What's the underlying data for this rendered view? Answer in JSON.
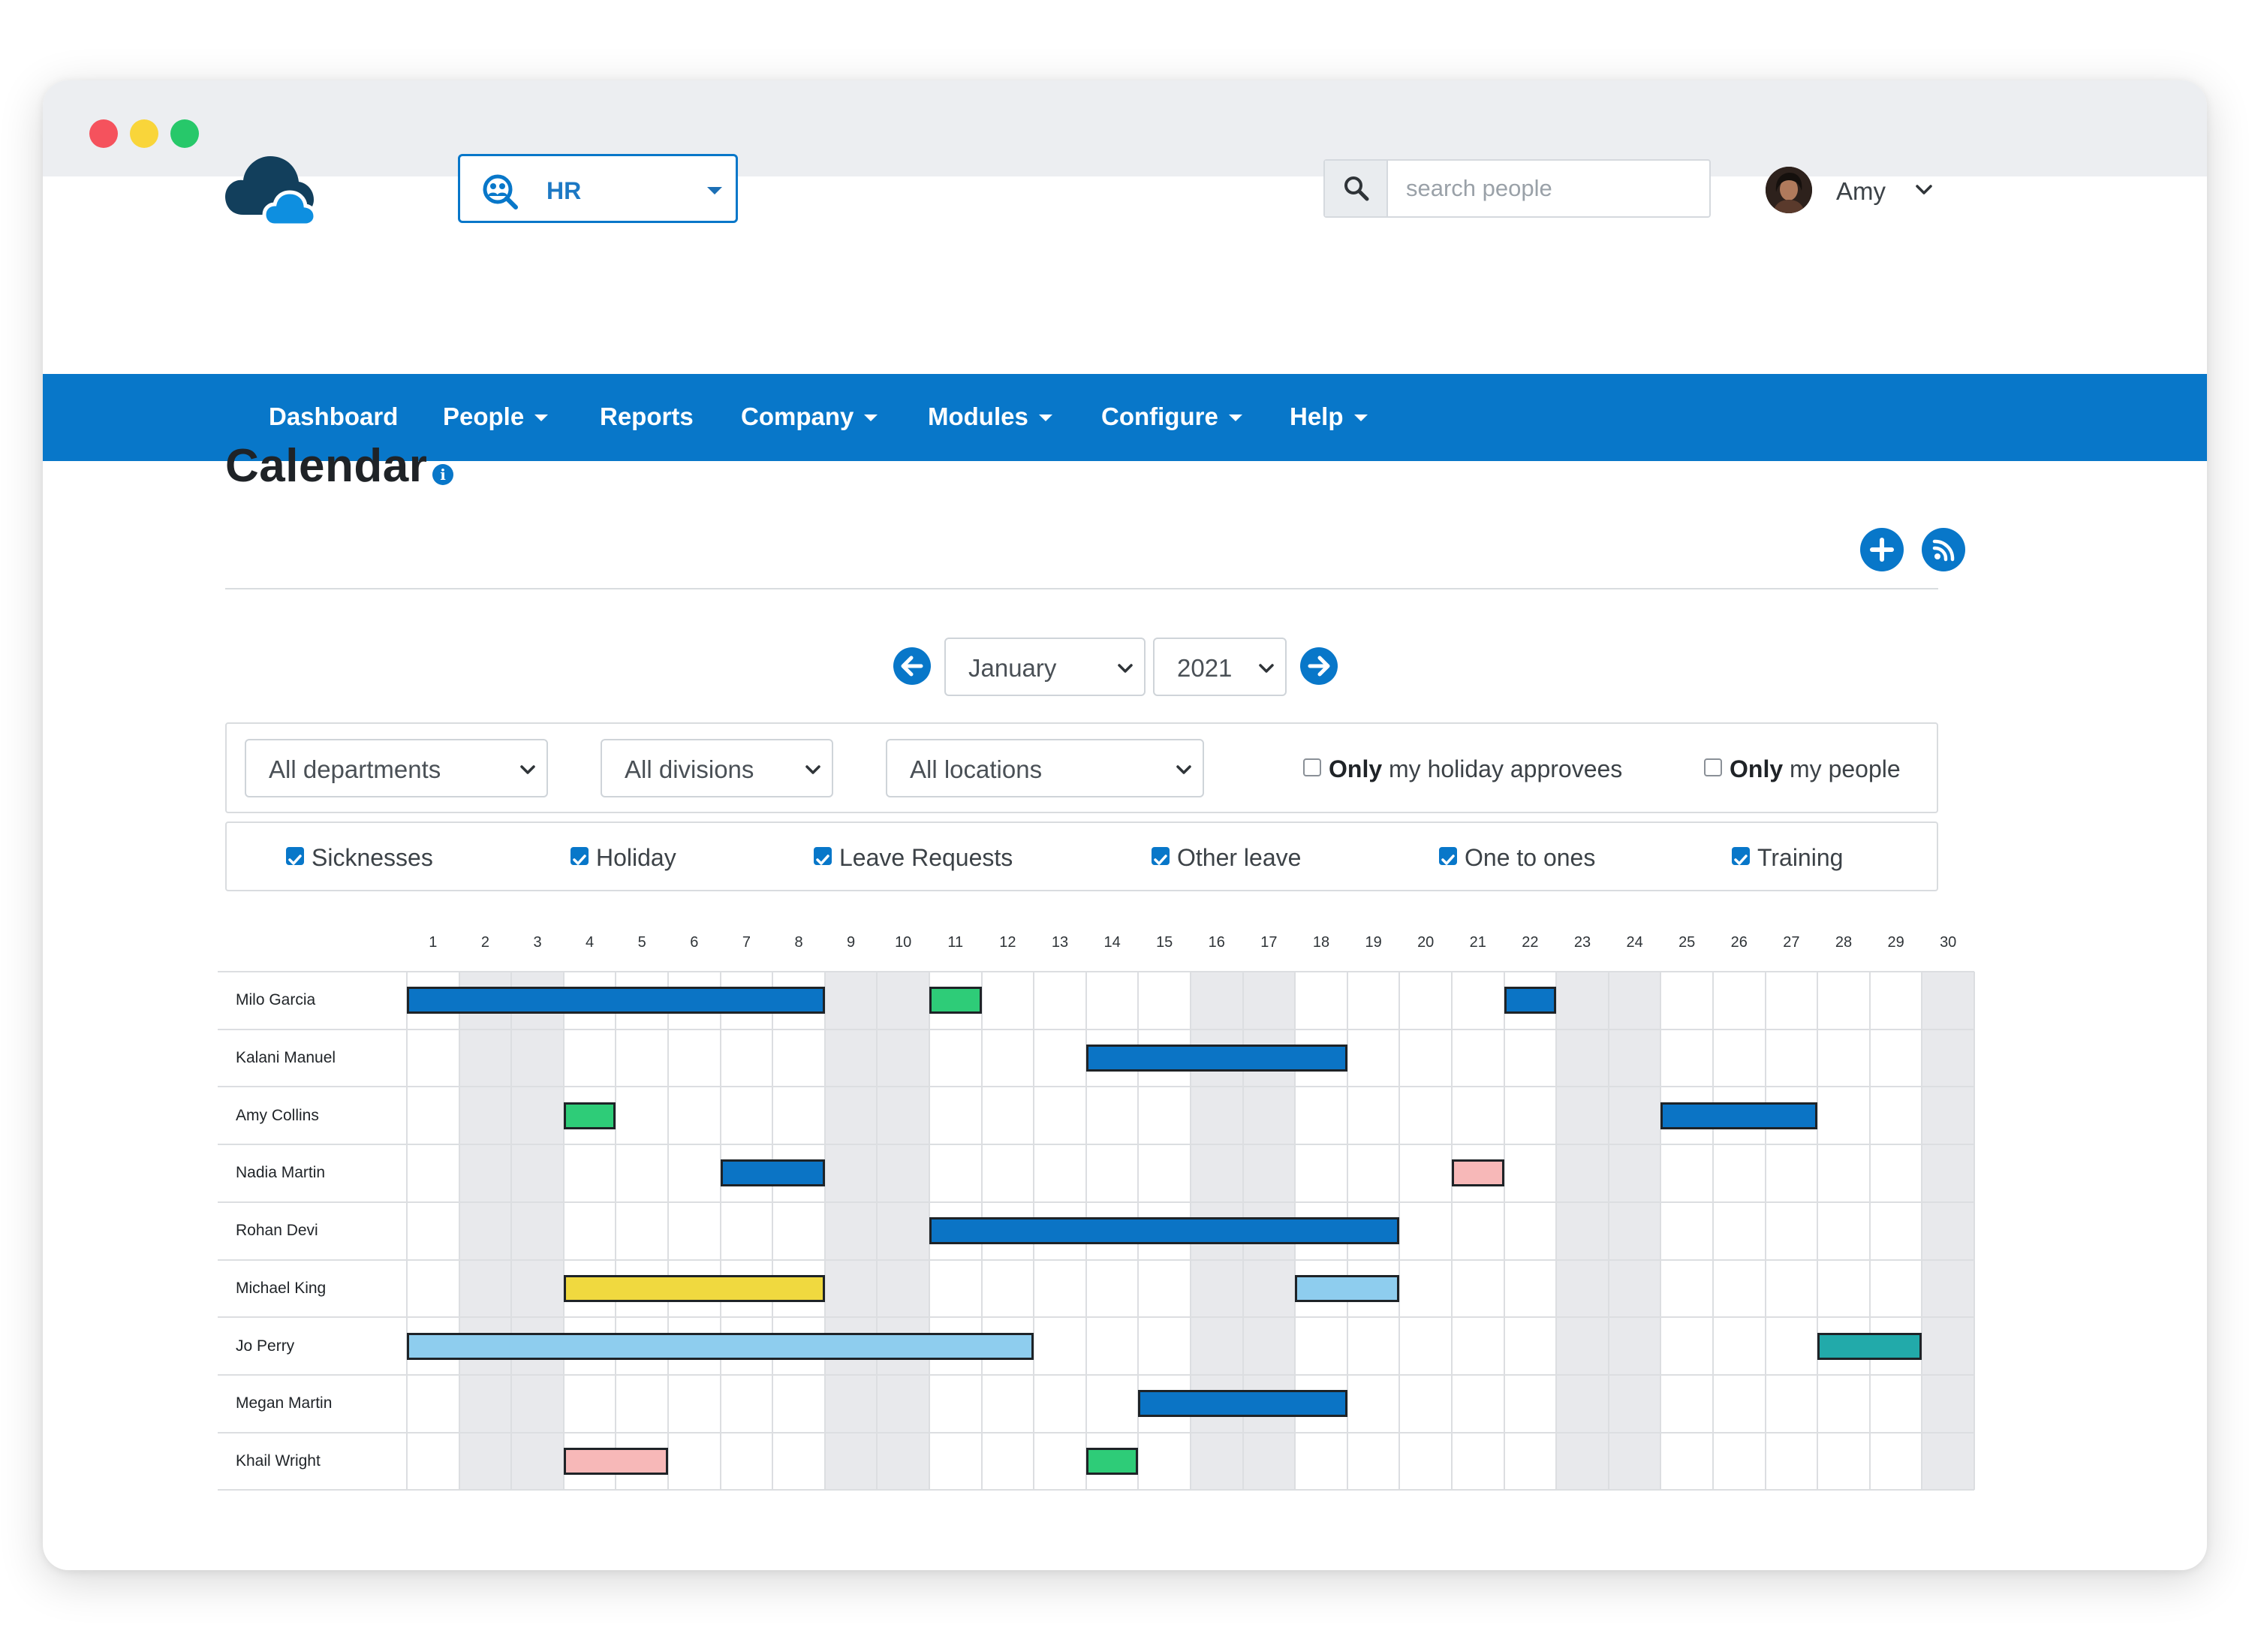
{
  "header": {
    "module": {
      "label": "HR"
    },
    "search": {
      "placeholder": "search people"
    },
    "user": {
      "name": "Amy"
    }
  },
  "nav": [
    {
      "label": "Dashboard",
      "dropdown": false
    },
    {
      "label": "People",
      "dropdown": true
    },
    {
      "label": "Reports",
      "dropdown": false
    },
    {
      "label": "Company",
      "dropdown": true
    },
    {
      "label": "Modules",
      "dropdown": true
    },
    {
      "label": "Configure",
      "dropdown": true
    },
    {
      "label": "Help",
      "dropdown": true
    }
  ],
  "page": {
    "title": "Calendar",
    "info_glyph": "i"
  },
  "period": {
    "month": "January",
    "year": "2021"
  },
  "filters": {
    "department": "All departments",
    "division": "All divisions",
    "location": "All locations",
    "holiday_approvees": {
      "bold": "Only",
      "rest": " my holiday approvees",
      "checked": false
    },
    "my_people": {
      "bold": "Only",
      "rest": " my people",
      "checked": false
    }
  },
  "leave_types": [
    {
      "label": "Sicknesses",
      "checked": true
    },
    {
      "label": "Holiday",
      "checked": true
    },
    {
      "label": "Leave Requests",
      "checked": true
    },
    {
      "label": "Other leave",
      "checked": true
    },
    {
      "label": "One to ones",
      "checked": true
    },
    {
      "label": "Training",
      "checked": true
    }
  ],
  "calendar": {
    "days": [
      "1",
      "2",
      "3",
      "4",
      "5",
      "6",
      "7",
      "8",
      "9",
      "10",
      "11",
      "12",
      "13",
      "14",
      "15",
      "16",
      "17",
      "18",
      "19",
      "20",
      "21",
      "22",
      "23",
      "24",
      "25",
      "26",
      "27",
      "28",
      "29",
      "30"
    ],
    "weekend_days": [
      2,
      3,
      9,
      10,
      16,
      17,
      23,
      24,
      30
    ],
    "colors": {
      "holiday": "#0b74c5",
      "sickness": "#2ecc78",
      "training": "#f0d93f",
      "leave_request": "#8ecdee",
      "other_leave": "#f7b8b8",
      "one_to_one": "#22aaaa"
    },
    "people": [
      {
        "name": "Milo Garcia",
        "events": [
          {
            "start": 1,
            "end": 8,
            "type": "holiday"
          },
          {
            "start": 11,
            "end": 11,
            "type": "sickness"
          },
          {
            "start": 22,
            "end": 22,
            "type": "holiday"
          }
        ]
      },
      {
        "name": "Kalani Manuel",
        "events": [
          {
            "start": 14,
            "end": 18,
            "type": "holiday"
          }
        ]
      },
      {
        "name": "Amy Collins",
        "events": [
          {
            "start": 4,
            "end": 4,
            "type": "sickness"
          },
          {
            "start": 25,
            "end": 27,
            "type": "holiday"
          }
        ]
      },
      {
        "name": "Nadia Martin",
        "events": [
          {
            "start": 7,
            "end": 8,
            "type": "holiday"
          },
          {
            "start": 21,
            "end": 21,
            "type": "other_leave"
          }
        ]
      },
      {
        "name": "Rohan Devi",
        "events": [
          {
            "start": 11,
            "end": 19,
            "type": "holiday"
          }
        ]
      },
      {
        "name": "Michael King",
        "events": [
          {
            "start": 4,
            "end": 8,
            "type": "training"
          },
          {
            "start": 18,
            "end": 19,
            "type": "leave_request"
          }
        ]
      },
      {
        "name": "Jo Perry",
        "events": [
          {
            "start": 1,
            "end": 12,
            "type": "leave_request"
          },
          {
            "start": 28,
            "end": 29,
            "type": "one_to_one"
          }
        ]
      },
      {
        "name": "Megan Martin",
        "events": [
          {
            "start": 15,
            "end": 18,
            "type": "holiday"
          }
        ]
      },
      {
        "name": "Khail Wright",
        "events": [
          {
            "start": 4,
            "end": 5,
            "type": "other_leave"
          },
          {
            "start": 14,
            "end": 14,
            "type": "sickness"
          }
        ]
      }
    ]
  }
}
